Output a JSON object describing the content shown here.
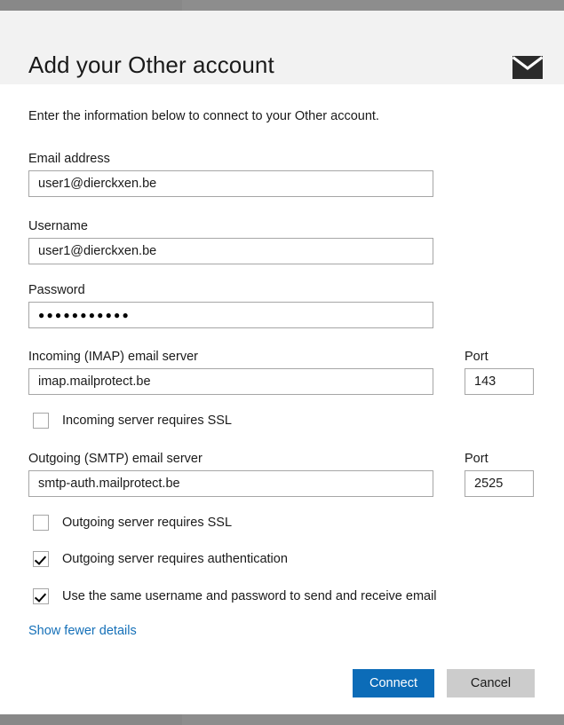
{
  "window": {
    "chrome_top_color": "#888888",
    "chrome_right_color": "#8d8d8d"
  },
  "header": {
    "title": "Add your Other account",
    "icon": "envelope-icon",
    "background": "#f2f2f2"
  },
  "main": {
    "intro": "Enter the information below to connect to your Other account.",
    "fields": [
      {
        "id": "email-address",
        "label": "Email address",
        "value": "user1@dierckxen.be",
        "placeholder": ""
      },
      {
        "id": "username",
        "label": "Username",
        "value": "user1@dierckxen.be",
        "placeholder": ""
      },
      {
        "id": "password",
        "label": "Password",
        "value": "●●●●●●●●●●●",
        "placeholder": ""
      },
      {
        "id": "incoming-server",
        "label": "Incoming (IMAP) email server",
        "value": "imap.mailprotect.be",
        "placeholder": ""
      },
      {
        "id": "outgoing-server",
        "label": "Outgoing (SMTP) email server",
        "value": "smtp-auth.mailprotect.be",
        "placeholder": ""
      }
    ],
    "ports": [
      {
        "id": "incoming-port",
        "label": "Port",
        "value": "143"
      },
      {
        "id": "outgoing-port",
        "label": "Port",
        "value": "2525"
      }
    ],
    "checkboxes": [
      {
        "id": "incoming-ssl",
        "label": "Incoming server requires SSL",
        "checked": false
      },
      {
        "id": "outgoing-ssl",
        "label": "Outgoing server requires SSL",
        "checked": false
      },
      {
        "id": "outgoing-auth",
        "label": "Outgoing server requires authentication",
        "checked": true
      },
      {
        "id": "same-credentials",
        "label": "Use the same username and password to send and receive email",
        "checked": true
      }
    ],
    "details_link": "Show fewer details",
    "link_color": "#1570b8"
  },
  "footer": {
    "connect_label": "Connect",
    "cancel_label": "Cancel",
    "connect_color": "#0c6cb8",
    "cancel_color": "#cccccc"
  }
}
